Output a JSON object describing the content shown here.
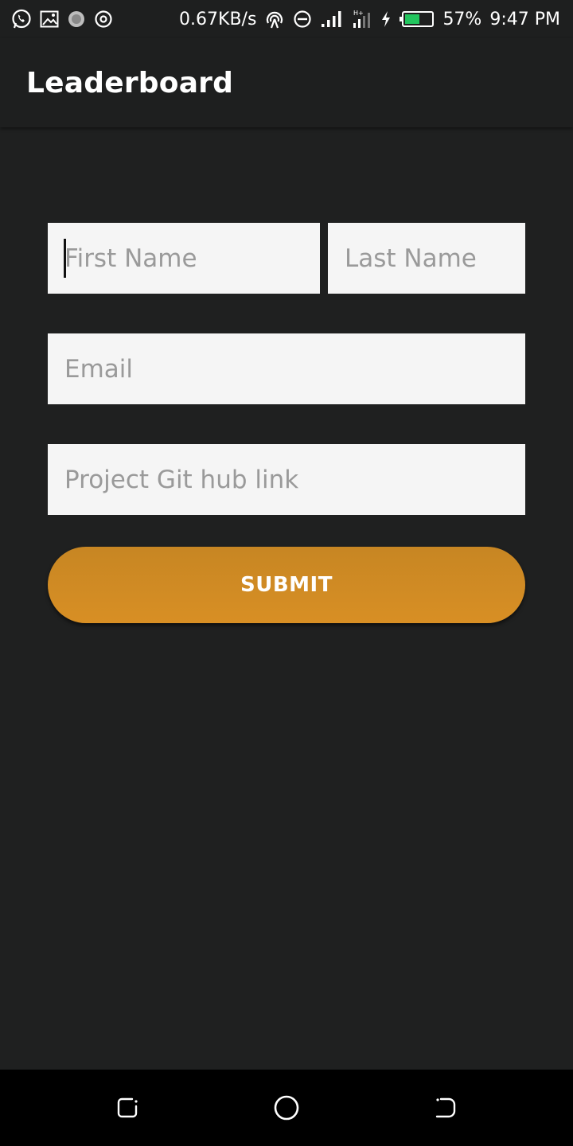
{
  "status_bar": {
    "net_speed": "0.67KB/s",
    "battery_percent": "57%",
    "battery_level": 0.57,
    "time": "9:47 PM",
    "icons": [
      "whatsapp-icon",
      "gallery-icon",
      "loading-icon",
      "sync-icon",
      "hotspot-icon",
      "dnd-icon",
      "signal-icon",
      "signal-2-icon",
      "charging-icon",
      "battery-icon"
    ],
    "accent_battery": "#22c55e"
  },
  "app_bar": {
    "title": "Leaderboard"
  },
  "form": {
    "first_name_placeholder": "First Name",
    "last_name_placeholder": "Last Name",
    "email_placeholder": "Email",
    "github_placeholder": "Project Git hub link",
    "submit_label": "SUBMIT",
    "submit_color": "#d08a23"
  },
  "nav_bar": {
    "icons": [
      "recents-icon",
      "home-icon",
      "back-icon"
    ]
  }
}
